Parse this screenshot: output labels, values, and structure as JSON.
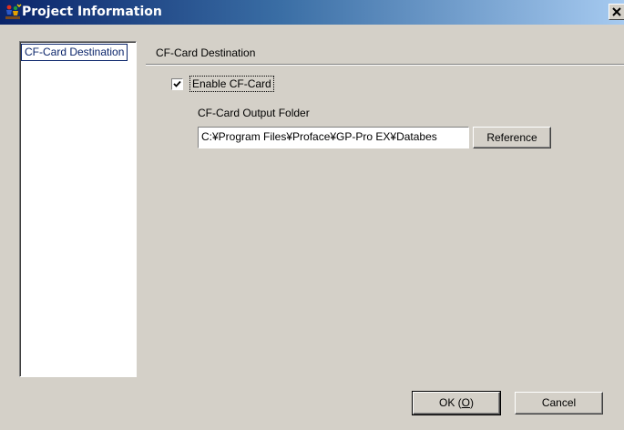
{
  "window": {
    "title": "Project Information",
    "close_label": "×"
  },
  "nav": {
    "items": [
      {
        "label": "CF-Card Destination",
        "selected": true
      }
    ]
  },
  "section": {
    "title": "CF-Card Destination"
  },
  "enable_cf_card": {
    "label": "Enable CF-Card",
    "checked": true
  },
  "output_folder": {
    "label": "CF-Card Output Folder",
    "value": "C:¥Program Files¥Proface¥GP-Pro EX¥Databes"
  },
  "buttons": {
    "reference": "Reference",
    "ok_prefix": "OK (",
    "ok_mnemonic": "O",
    "ok_suffix": ")",
    "cancel": "Cancel"
  },
  "colors": {
    "dialog_bg": "#d4d0c8",
    "titlebar_start": "#0a246a",
    "titlebar_end": "#a6caf0",
    "selection": "#0a246a"
  },
  "icons": {
    "title_icon": "project-app-icon",
    "close": "close-icon",
    "check": "check-mark-icon"
  }
}
